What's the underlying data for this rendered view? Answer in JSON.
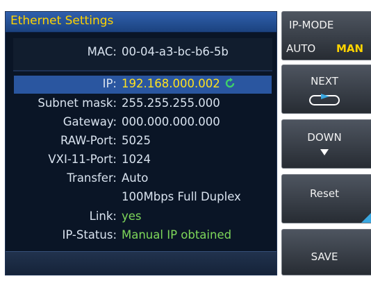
{
  "window": {
    "title": "Ethernet Settings"
  },
  "mac": {
    "label": "MAC:",
    "value": "00-04-a3-bc-b6-5b"
  },
  "settings": [
    {
      "label": "IP:",
      "value": "192.168.000.002",
      "style": "yellow"
    },
    {
      "label": "Subnet mask:",
      "value": "255.255.255.000"
    },
    {
      "label": "Gateway:",
      "value": "000.000.000.000"
    },
    {
      "label": "RAW-Port:",
      "value": "5025"
    },
    {
      "label": "VXI-11-Port:",
      "value": "1024"
    },
    {
      "label": "Transfer:",
      "value": "Auto"
    },
    {
      "label": "",
      "value": "100Mbps Full Duplex"
    },
    {
      "label": "Link:",
      "value": "yes",
      "style": "green"
    },
    {
      "label": "IP-Status:",
      "value": "Manual IP obtained",
      "style": "green"
    }
  ],
  "softkeys": {
    "ip_mode": {
      "label": "IP-MODE",
      "option_auto": "AUTO",
      "option_man": "MAN",
      "selected": "MAN"
    },
    "next": {
      "label": "NEXT",
      "icon": "next-arrow-icon"
    },
    "down": {
      "label": "DOWN",
      "icon": "down-triangle-icon"
    },
    "reset": {
      "label": "Reset",
      "icon": "corner-triangle-icon"
    },
    "save": {
      "label": "SAVE"
    }
  },
  "colors": {
    "title_text": "#ffd400",
    "ip_value": "#ffe21f",
    "status_green": "#7ed85a",
    "selected_row": "#2a56a0",
    "accent_cyan": "#3aa7e0"
  }
}
